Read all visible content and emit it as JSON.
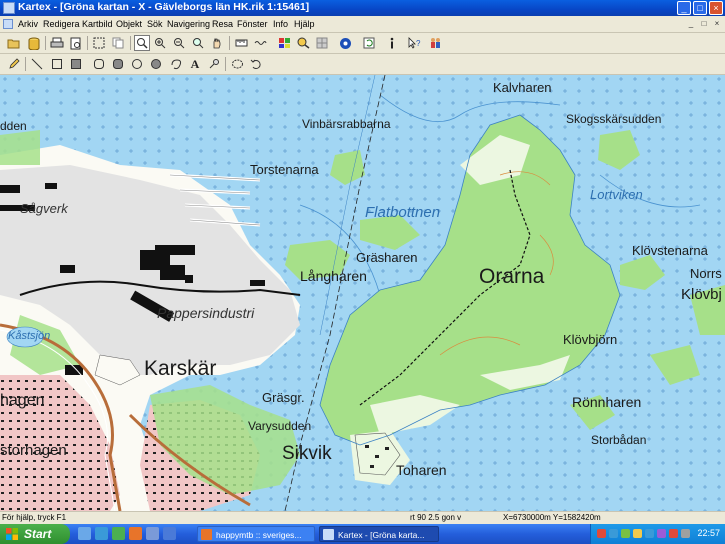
{
  "window": {
    "title": "Kartex - [Gröna kartan - X - Gävleborgs län HK.rik 1:15461]",
    "controls": [
      "_",
      "□",
      "×"
    ]
  },
  "menubar": {
    "items": [
      "Arkiv",
      "Redigera",
      "Kartbild",
      "Objekt",
      "Sök",
      "Navigering",
      "Resa",
      "Fönster",
      "Info",
      "Hjälp"
    ]
  },
  "toolbar1": {
    "icons": [
      "open-folder",
      "database",
      "print",
      "print-preview",
      "select-rectangle",
      "copy",
      "zoom-pointer",
      "zoom-in",
      "zoom-out",
      "zoom-fit",
      "pan-hand",
      "ruler",
      "wave",
      "map-layers",
      "find-object",
      "layer-grid",
      "compass-dot",
      "refresh",
      "info",
      "help-pointer",
      "people"
    ]
  },
  "toolbar2": {
    "icons": [
      "pencil",
      "line",
      "rectangle",
      "filled-rectangle",
      "rounded-rectangle",
      "filled-rounded-rectangle",
      "circle",
      "filled-circle",
      "lasso",
      "text",
      "pin",
      "select-ellipse",
      "undo-loop"
    ],
    "text_tool_glyph": "A"
  },
  "map": {
    "labels": {
      "kalvharen": "Kalvharen",
      "vinbarsrabbarna": "Vinbärsrabbarna",
      "skogsskarsudden": "Skogsskärsudden",
      "torstenarna": "Torstenarna",
      "sagverk": "Sågverk",
      "flatbottnen": "Flatbottnen",
      "lortviken": "Lortviken",
      "grasharen": "Gräsharen",
      "klovstenarna": "Klövstenarna",
      "norrs": "Norrs",
      "langharen": "Långharen",
      "orarna": "Orarna",
      "klovbj": "Klövbj",
      "pappersindustri": "Pappersindustri",
      "kastsjon": "Kåstsjön",
      "klovbjorn": "Klövbjörn",
      "karskar": "Karskär",
      "hagen": "hagen",
      "grasgr": "Gräsgr.",
      "ronnharen": "Rönnharen",
      "varysudden": "Varysudden",
      "storbadan": "Storbådan",
      "storhagen": "storhagen",
      "sikvik": "Sikvik",
      "toharen": "Toharen",
      "udden": "dden"
    }
  },
  "statusbar": {
    "help": "För hjälp, tryck F1",
    "rotation": "rt 90 2.5 gon v",
    "coordinates": "X=6730000m Y=1582420m"
  },
  "taskbar": {
    "start_label": "Start",
    "tasks": [
      "happymtb :: sveriges...",
      "Kartex - [Gröna karta..."
    ],
    "clock": "22:57"
  }
}
